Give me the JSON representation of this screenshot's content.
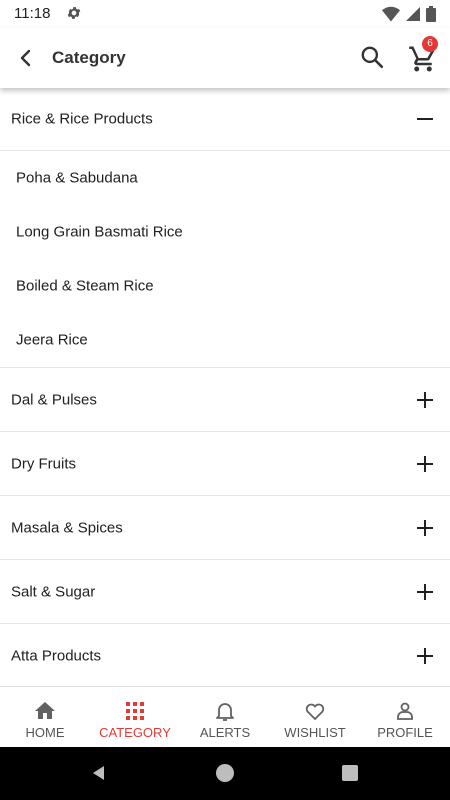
{
  "status": {
    "time": "11:18"
  },
  "appbar": {
    "title": "Category",
    "cart_count": "6"
  },
  "expanded_category": {
    "label": "Rice & Rice Products",
    "subcategories": [
      "Poha & Sabudana",
      "Long Grain Basmati  Rice",
      "Boiled & Steam Rice",
      "Jeera Rice"
    ]
  },
  "categories": [
    {
      "label": "Dal & Pulses"
    },
    {
      "label": "Dry Fruits"
    },
    {
      "label": "Masala & Spices"
    },
    {
      "label": "Salt & Sugar"
    },
    {
      "label": "Atta Products"
    }
  ],
  "bottom_nav": [
    {
      "label": "HOME",
      "icon": "home-icon"
    },
    {
      "label": "CATEGORY",
      "icon": "grid-icon",
      "active": true
    },
    {
      "label": "ALERTS",
      "icon": "bell-icon"
    },
    {
      "label": "WISHLIST",
      "icon": "heart-icon"
    },
    {
      "label": "PROFILE",
      "icon": "person-icon"
    }
  ],
  "colors": {
    "accent": "#e53935",
    "text": "#212121",
    "divider": "#e6e6e6"
  }
}
